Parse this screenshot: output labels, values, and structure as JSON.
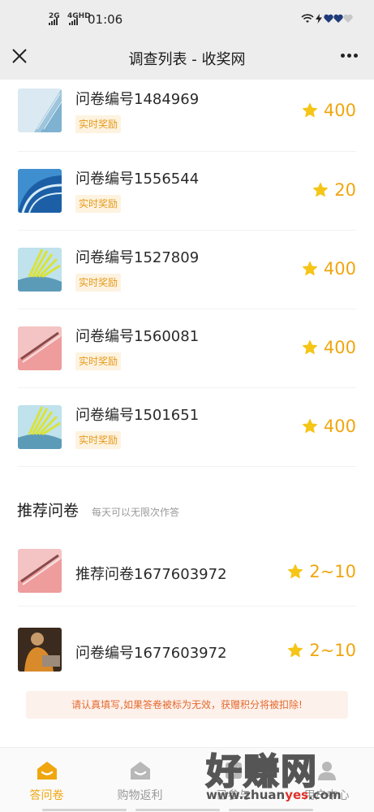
{
  "status": {
    "net1": "2G",
    "net2": "4GHD",
    "time": "01:06"
  },
  "nav": {
    "title": "调查列表 - 收奖网"
  },
  "surveys": [
    {
      "title": "问卷编号1484969",
      "tag": "实时奖励",
      "reward": "400",
      "thumb": "tower-blue"
    },
    {
      "title": "问卷编号1556544",
      "tag": "实时奖励",
      "reward": "20",
      "thumb": "arch-blue"
    },
    {
      "title": "问卷编号1527809",
      "tag": "实时奖励",
      "reward": "400",
      "thumb": "leaf-teal"
    },
    {
      "title": "问卷编号1560081",
      "tag": "实时奖励",
      "reward": "400",
      "thumb": "pink-pen"
    },
    {
      "title": "问卷编号1501651",
      "tag": "实时奖励",
      "reward": "400",
      "thumb": "leaf-teal"
    }
  ],
  "recommend": {
    "title": "推荐问卷",
    "subtitle": "每天可以无限次作答",
    "items": [
      {
        "title": "推荐问卷1677603972",
        "reward": "2~10",
        "thumb": "pink-pen"
      },
      {
        "title": "问卷编号1677603972",
        "reward": "2~10",
        "thumb": "person-brown"
      }
    ]
  },
  "notice": "请认真填写,如果答卷被标为无效，获赠积分将被扣除!",
  "tabs": [
    {
      "label": "答问卷",
      "active": true
    },
    {
      "label": "购物返利",
      "active": false
    },
    {
      "label": "已参与",
      "active": false
    },
    {
      "label": "用户中心",
      "active": false
    }
  ],
  "watermark": {
    "big": "好赚网",
    "small_prefix": "www.zhuan",
    "small_highlight": "yes",
    "small_suffix": ".com"
  },
  "colors": {
    "accent": "#f0a60f",
    "tag_bg": "#fdf3e0",
    "notice_text": "#e46a2e"
  }
}
